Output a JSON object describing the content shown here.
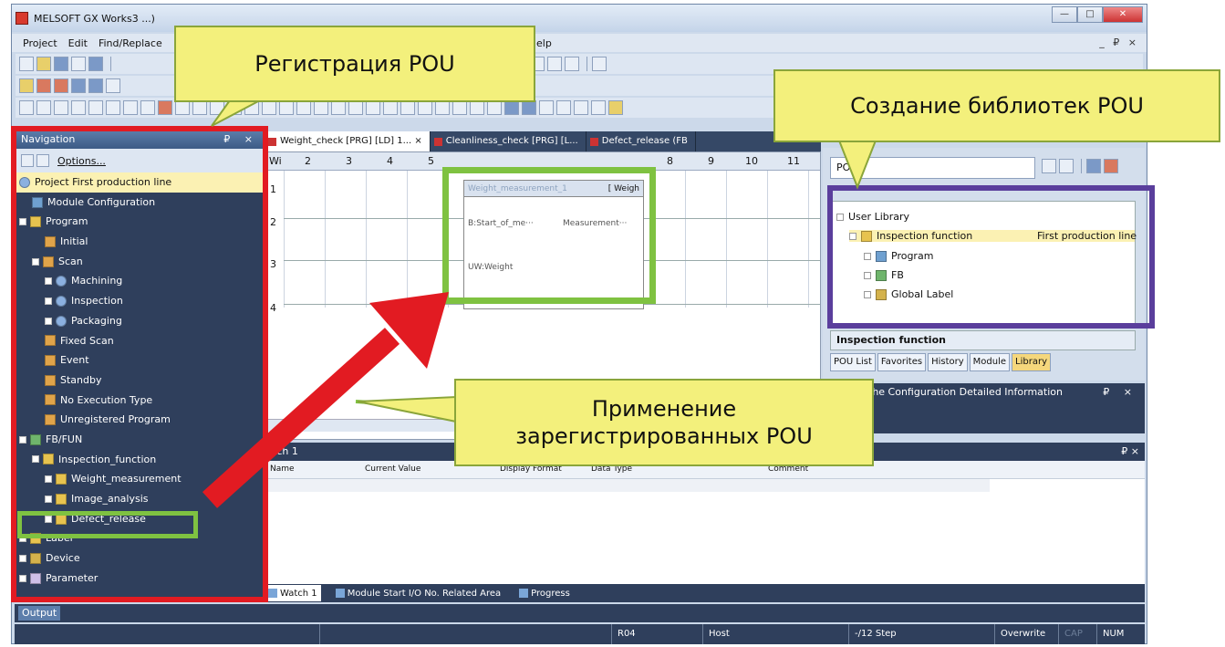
{
  "window": {
    "title": "MELSOFT GX Works3 ...)",
    "mdi_controls": "_ ₽ ×",
    "buttons": {
      "minimize": "—",
      "maximize": "□",
      "close": "✕"
    }
  },
  "menu": [
    "Project",
    "Edit",
    "Find/Replace",
    "Help"
  ],
  "navigation": {
    "title": "Navigation",
    "header_controls": "₽ ×",
    "options_label": "Options...",
    "items": [
      {
        "label": "Project First production line",
        "indent": 0,
        "icon": "gear",
        "selected": true,
        "expander": false
      },
      {
        "label": "Module Configuration",
        "indent": 1,
        "icon": "module",
        "expander": false
      },
      {
        "label": "Program",
        "indent": 0,
        "icon": "folder",
        "expander": true
      },
      {
        "label": "Initial",
        "indent": 2,
        "icon": "prog",
        "expander": false
      },
      {
        "label": "Scan",
        "indent": 1,
        "icon": "prog",
        "expander": true
      },
      {
        "label": "Machining",
        "indent": 2,
        "icon": "gear",
        "expander": true
      },
      {
        "label": "Inspection",
        "indent": 2,
        "icon": "gear",
        "expander": true
      },
      {
        "label": "Packaging",
        "indent": 2,
        "icon": "gear",
        "expander": true
      },
      {
        "label": "Fixed Scan",
        "indent": 2,
        "icon": "prog",
        "expander": false
      },
      {
        "label": "Event",
        "indent": 2,
        "icon": "prog",
        "expander": false
      },
      {
        "label": "Standby",
        "indent": 2,
        "icon": "prog",
        "expander": false
      },
      {
        "label": "No Execution Type",
        "indent": 2,
        "icon": "prog",
        "expander": false
      },
      {
        "label": "Unregistered Program",
        "indent": 2,
        "icon": "prog",
        "expander": false
      },
      {
        "label": "FB/FUN",
        "indent": 0,
        "icon": "fb",
        "expander": true
      },
      {
        "label": "Inspection_function",
        "indent": 1,
        "icon": "folder",
        "expander": true
      },
      {
        "label": "Weight_measurement",
        "indent": 2,
        "icon": "folder",
        "expander": true
      },
      {
        "label": "Image_analysis",
        "indent": 2,
        "icon": "folder",
        "expander": true
      },
      {
        "label": "Defect_release",
        "indent": 2,
        "icon": "folder",
        "expander": true
      },
      {
        "label": "Label",
        "indent": 0,
        "icon": "folder",
        "expander": true
      },
      {
        "label": "Device",
        "indent": 0,
        "icon": "dev",
        "expander": true
      },
      {
        "label": "Parameter",
        "indent": 0,
        "icon": "param",
        "expander": true
      }
    ]
  },
  "editor_tabs": [
    {
      "label": "Weight_check [PRG] [LD] 1... ×",
      "active": true
    },
    {
      "label": "Cleanliness_check [PRG] [L...",
      "active": false
    },
    {
      "label": "Defect_release (FB",
      "active": false
    }
  ],
  "ladder": {
    "columns": [
      "Wi",
      "2",
      "3",
      "4",
      "5",
      "8",
      "9",
      "10",
      "11"
    ],
    "rows": [
      "1",
      "2",
      "3",
      "4"
    ],
    "fb_title": "Weight_measurement_1",
    "fb_type": "[ Weigh",
    "fb_in1": "B:Start_of_me···",
    "fb_out1": "Measurement···",
    "fb_in2": "UW:Weight"
  },
  "library": {
    "search": "POU)",
    "tree": [
      {
        "label": "User Library",
        "value": ""
      },
      {
        "label": "Inspection function",
        "value": "First production line"
      },
      {
        "label": "Program",
        "value": ""
      },
      {
        "label": "FB",
        "value": ""
      },
      {
        "label": "Global Label",
        "value": ""
      }
    ],
    "status": "Inspection function",
    "tabs": [
      {
        "label": "POU List",
        "active": false
      },
      {
        "label": "Favorites",
        "active": false
      },
      {
        "label": "History",
        "active": false
      },
      {
        "label": "Module",
        "active": false
      },
      {
        "label": "Library",
        "active": true
      }
    ]
  },
  "config_panel": {
    "title": "the Configuration Detailed Information",
    "controls": "₽ ×"
  },
  "watch": {
    "title": "itch 1",
    "controls": "₽ ×",
    "columns": [
      "Name",
      "Current Value",
      "Display Format",
      "Data Type",
      "Comment"
    ]
  },
  "bottom_tabs": [
    "Watch 1",
    "Module Start I/O No. Related Area",
    "Progress"
  ],
  "output_label": "Output",
  "statusbar": [
    "R04",
    "Host",
    "-/12 Step",
    "Overwrite",
    "CAP",
    "NUM"
  ],
  "callouts": {
    "registration": "Регистрация POU",
    "library_creation": "Создание библиотек POU",
    "application_line1": "Применение",
    "application_line2": "зарегистрированных POU"
  },
  "colors": {
    "red": "#e21b22",
    "green": "#7fc241",
    "purple": "#5a3e9c",
    "callout": "#f3f07c",
    "panel": "#2f3f5c"
  }
}
